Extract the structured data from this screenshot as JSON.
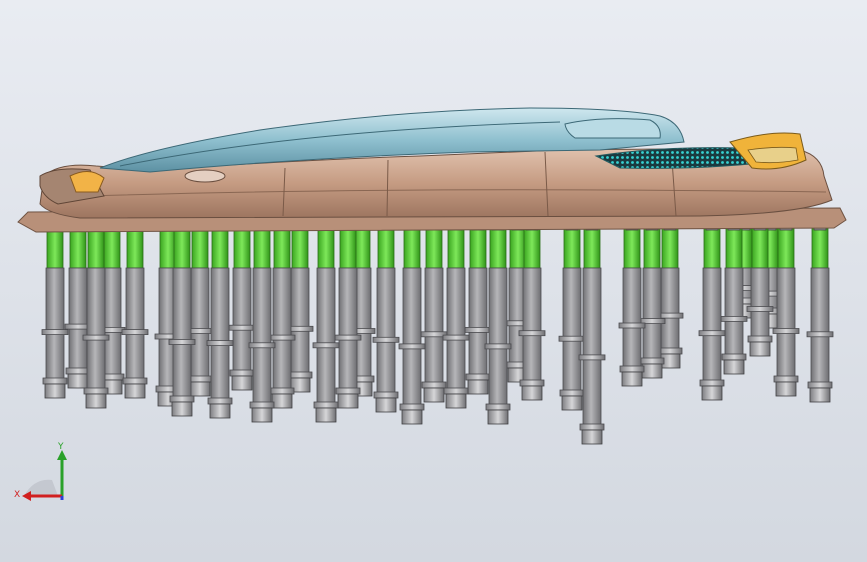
{
  "viewport": {
    "background_top": "#e9ecf2",
    "background_bottom": "#d3d8e0"
  },
  "model": {
    "body_color": "#c9a188",
    "body_shadow": "#a57d66",
    "roof_color": "#8ec0cf",
    "roof_dark": "#5f94a6",
    "pin_body_color": "#9a9a9d",
    "pin_collar_color": "#5fd23a",
    "pin_nut_color": "#b8b8bb",
    "accent_color": "#f0b33a",
    "mesh_color": "#2fc5c5"
  },
  "triad": {
    "x_label": "X",
    "y_label": "Y",
    "x_color": "#d11f1f",
    "y_color": "#2aa12a",
    "z_color": "#2c3fd6"
  }
}
